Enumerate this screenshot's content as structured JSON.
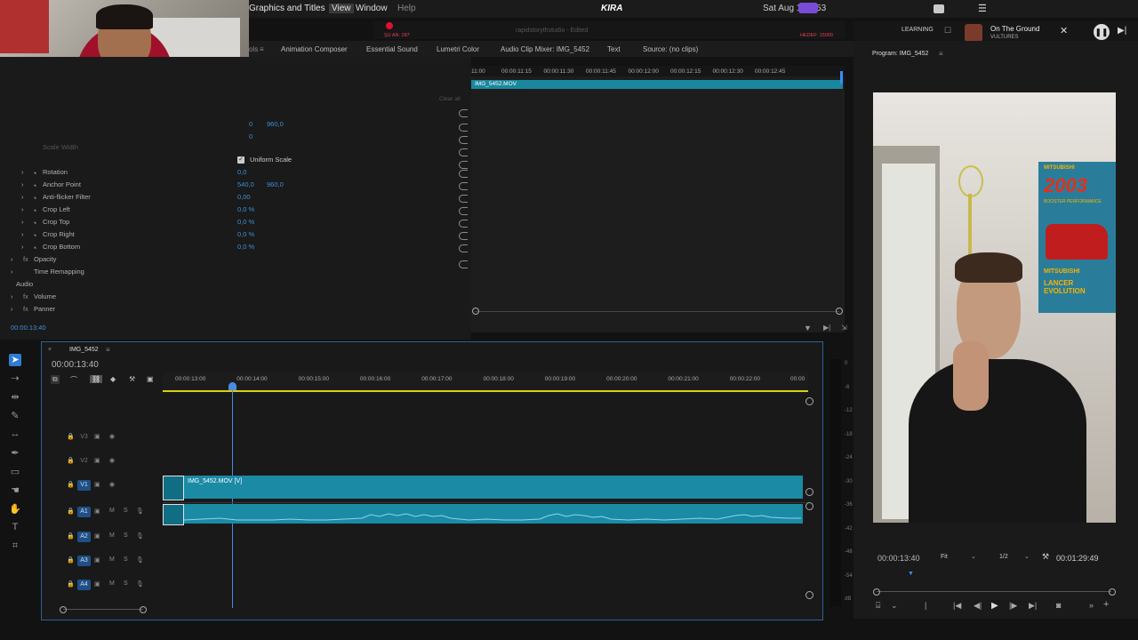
{
  "app": {
    "menubar": {
      "items": [
        "Graphics and Titles",
        "View",
        "Window",
        "Help"
      ],
      "center_brand": "KIRA",
      "center_small": "rapidstorythstudio - Edited",
      "live_left": "ŞU AN: 287",
      "live_right": "HEDEF: 15000",
      "clock": "Sat Aug 1  14:53"
    },
    "now_playing": {
      "title": "On The Ground",
      "artist": "VULTURES"
    },
    "workspace_label": "LEARNING",
    "tabs": [
      "Animation Composer",
      "Essential Sound",
      "Lumetri Color",
      "Audio Clip Mixer: IMG_5452",
      "Text",
      "Source: (no clips)"
    ],
    "tab_prefix": "ols"
  },
  "effect_controls": {
    "clip_name": "IMG_5452.MOV",
    "clear_all": "Clear all",
    "position_values": [
      "0",
      "960,0"
    ],
    "position_value_2": "0",
    "scale_width_label": "Scale Width",
    "uniform_scale": "Uniform Scale",
    "rows": [
      {
        "label": "Rotation",
        "value": "0,0"
      },
      {
        "label": "Anchor Point",
        "value": "540,0",
        "value2": "960,0"
      },
      {
        "label": "Anti-flicker Filter",
        "value": "0,00"
      },
      {
        "label": "Crop Left",
        "value": "0,0 %"
      },
      {
        "label": "Crop Top",
        "value": "0,0 %"
      },
      {
        "label": "Crop Right",
        "value": "0,0 %"
      },
      {
        "label": "Crop Bottom",
        "value": "0,0 %"
      }
    ],
    "groups": [
      "Opacity",
      "Time Remapping"
    ],
    "audio_label": "Audio",
    "audio_groups": [
      "Volume",
      "Panner"
    ],
    "timecode": "00:00:13:40",
    "ruler_ticks": [
      "11:00",
      "00:00:11:15",
      "00:00:11:30",
      "00:00:11:45",
      "00:00:12:00",
      "00:00:12:15",
      "00:00:12:30",
      "00:00:12:45"
    ]
  },
  "program_monitor": {
    "title": "Program: IMG_5452",
    "timecode": "00:00:13:40",
    "fit": "Fit",
    "resolution": "1/2",
    "duration": "00:01:29:49",
    "poster_lines": [
      "MITSUBISHI",
      "2003",
      "BOOSTER PERFORMANCE",
      "MITSUBISHI",
      "LANCER EVOLUTION"
    ]
  },
  "timeline": {
    "sequence_name": "IMG_5452",
    "timecode": "00:00:13:40",
    "ruler_ticks": [
      "00:00:13:00",
      "00:00:14:00",
      "00:00:15:00",
      "00:00:16:00",
      "00:00:17:00",
      "00:00:18:00",
      "00:00:19:00",
      "00:00:20:00",
      "00:00:21:00",
      "00:00:22:00",
      "00:00"
    ],
    "video_tracks": [
      "V3",
      "V2",
      "V1"
    ],
    "audio_tracks": [
      "A1",
      "A2",
      "A3",
      "A4"
    ],
    "clip_label": "IMG_5452.MOV [V]",
    "meter_ticks": [
      "0",
      "-6",
      "-12",
      "-18",
      "-24",
      "-30",
      "-36",
      "-42",
      "-48",
      "-54",
      "dB"
    ]
  },
  "colors": {
    "accent_blue": "#2f7bd6",
    "clip_teal": "#1b8aa5",
    "panel_bg": "#1a1a1a"
  }
}
